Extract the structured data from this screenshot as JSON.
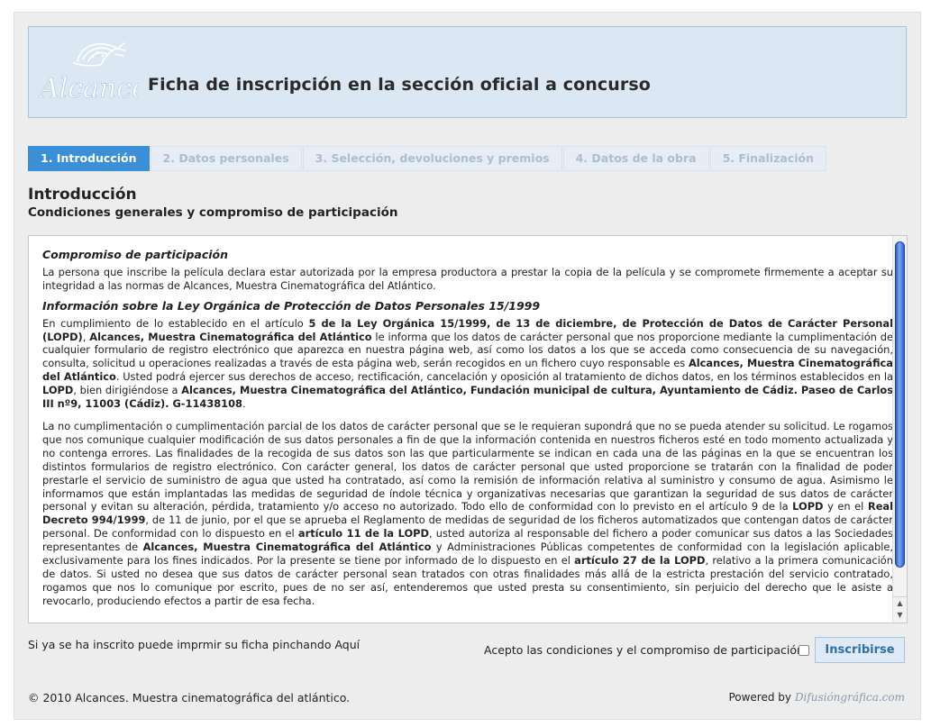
{
  "header": {
    "logo_text": "Alcances",
    "title": "Ficha de inscripción en la sección oficial a concurso"
  },
  "tabs": [
    {
      "label": "1. Introducción",
      "active": true
    },
    {
      "label": "2. Datos personales",
      "active": false
    },
    {
      "label": "3. Selección, devoluciones y premios",
      "active": false
    },
    {
      "label": "4. Datos de la obra",
      "active": false
    },
    {
      "label": "5. Finalización",
      "active": false
    }
  ],
  "section": {
    "title": "Introducción",
    "subtitle": "Condiciones generales y compromiso de participación"
  },
  "terms": {
    "heading1": "Compromiso de participación",
    "p1": "La persona que inscribe la película declara estar autorizada por la empresa productora a prestar la copia de la película y se compromete firmemente a aceptar su integridad a las normas de Alcances, Muestra Cinematográfica del Atlántico.",
    "heading2": "Información sobre la Ley Orgánica de Protección de Datos Personales 15/1999",
    "p2_a": "En cumplimiento de lo establecido en el artículo ",
    "p2_b": "5 de la Ley Orgánica 15/1999, de 13 de diciembre, de Protección de Datos de Carácter Personal (LOPD)",
    "p2_c": ", ",
    "p2_d": "Alcances, Muestra Cinematográfica del Atlántico",
    "p2_e": " le informa que los datos de carácter personal que nos proporcione mediante la cumplimentación de cualquier formulario de registro electrónico que aparezca en nuestra página web, así como los datos a los que se acceda como consecuencia de su navegación, consulta, solicitud u operaciones realizadas a través de esta página web, serán recogidos en un fichero cuyo responsable es ",
    "p2_f": "Alcances, Muestra Cinematográfica del Atlántico",
    "p2_g": ". Usted podrá ejercer sus derechos de acceso, rectificación, cancelación y oposición al tratamiento de dichos datos, en los términos establecidos en la ",
    "p2_h": "LOPD",
    "p2_i": ", bien dirigiéndose a ",
    "p2_j": "Alcances, Muestra Cinematográfica del Atlántico, Fundación municipal de cultura, Ayuntamiento de Cádiz. Paseo de Carlos III nº9, 11003 (Cádiz). G-11438108",
    "p2_k": ".",
    "p3_a": "La no cumplimentación o cumplimentación parcial de los datos de carácter personal que se le requieran supondrá que no se pueda atender su solicitud. Le rogamos que nos comunique cualquier modificación de sus datos personales a fin de que la información contenida en nuestros ficheros esté en todo momento actualizada y no contenga errores. Las finalidades de la recogida de sus datos son las que particularmente se indican en cada una de las páginas en la que se encuentran los distintos formularios de registro electrónico. Con carácter general, los datos de carácter personal que usted proporcione se tratarán con la finalidad de poder prestarle el servicio de suministro de agua que usted ha contratado, así como la remisión de información relativa al suministro y consumo de agua. Asimismo le informamos que están implantadas las medidas de seguridad de índole técnica y organizativas necesarias que garantizan la seguridad de sus datos de carácter personal y evitan su alteración, pérdida, tratamiento y/o acceso no autorizado. Todo ello de conformidad con lo previsto en el artículo 9 de la ",
    "p3_b": "LOPD",
    "p3_c": " y en el ",
    "p3_d": "Real Decreto 994/1999",
    "p3_e": ", de 11 de junio, por el que se aprueba el Reglamento de medidas de seguridad de los ficheros automatizados que contengan datos de carácter personal. De conformidad con lo dispuesto en el ",
    "p3_f": "artículo 11 de la LOPD",
    "p3_g": ", usted autoriza al responsable del fichero a poder comunicar sus datos a las Sociedades representantes de ",
    "p3_h": "Alcances, Muestra Cinematográfica del Atlántico",
    "p3_i": " y Administraciones Públicas competentes de conformidad con la legislación aplicable, exclusivamente para los fines indicados. Por la presente se tiene por informado de lo dispuesto en el ",
    "p3_j": "artículo 27 de la LOPD",
    "p3_k": ", relativo a la primera comunicación de datos. Si usted no desea que sus datos de carácter personal sean tratados con otras finalidades más allá de la estricta prestación del servicio contratado, rogamos que nos lo comunique por escrito, pues de no ser así, entenderemos que usted presta su consentimiento, sin perjuicio del derecho que le asiste a revocarlo, produciendo efectos a partir de esa fecha."
  },
  "print_note": "Si ya se ha inscrito puede imprmir su ficha pinchando Aquí",
  "accept": {
    "label": "Acepto las condiciones y el compromiso de participación",
    "checked": false
  },
  "submit_label": "Inscribirse",
  "footer": {
    "copyright": "© 2010 Alcances. Muestra cinematográfica del atlántico.",
    "powered_by": "Powered by",
    "brand": "Difusióngráfica.com"
  },
  "colors": {
    "active_tab": "#3a8fd6",
    "header_bg": "#dbe7f3",
    "scroll_thumb": "#2d5fd0"
  }
}
